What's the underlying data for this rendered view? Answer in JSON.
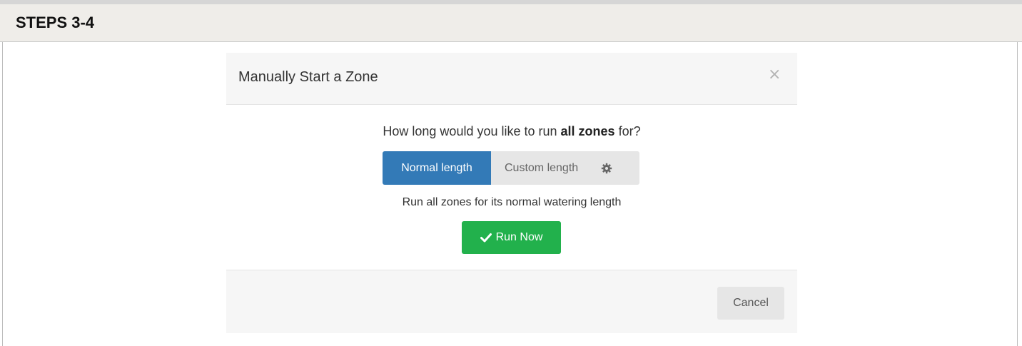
{
  "section": {
    "title": "STEPS 3-4"
  },
  "modal": {
    "title": "Manually Start a Zone",
    "close_symbol": "×",
    "question_prefix": "How long would you like to run ",
    "question_bold": "all zones",
    "question_suffix": " for?",
    "length_options": {
      "normal_label": "Normal length",
      "custom_label": "Custom length",
      "selected": "Normal length"
    },
    "help_text": "Run all zones for its normal watering length",
    "run_now_label": "Run Now",
    "cancel_label": "Cancel"
  },
  "icons": {
    "close": "close-icon",
    "settings": "gear-icon",
    "confirm": "check-icon"
  },
  "colors": {
    "primary": "#337ab7",
    "success": "#22b14c",
    "header_bg": "#efede9",
    "button_default": "#e6e6e6"
  }
}
